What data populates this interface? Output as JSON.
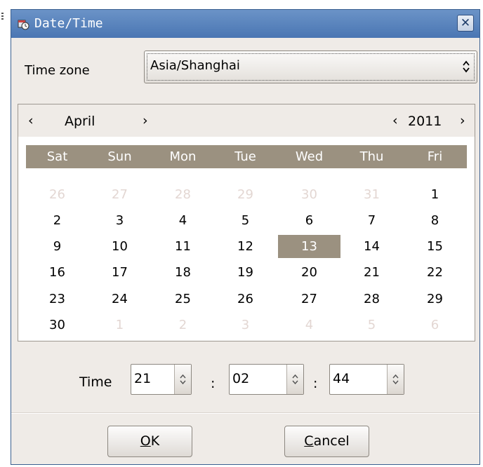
{
  "window": {
    "title": "Date/Time"
  },
  "timezone": {
    "label": "Time zone",
    "value": "Asia/Shanghai"
  },
  "calendar": {
    "prev_month": "‹",
    "month": "April",
    "next_month": "›",
    "prev_year": "‹",
    "year": "2011",
    "next_year": "›",
    "weekdays": [
      "Sat",
      "Sun",
      "Mon",
      "Tue",
      "Wed",
      "Thu",
      "Fri"
    ],
    "weeks": [
      [
        "26",
        "27",
        "28",
        "29",
        "30",
        "31",
        "1"
      ],
      [
        "2",
        "3",
        "4",
        "5",
        "6",
        "7",
        "8"
      ],
      [
        "9",
        "10",
        "11",
        "12",
        "13",
        "14",
        "15"
      ],
      [
        "16",
        "17",
        "18",
        "19",
        "20",
        "21",
        "22"
      ],
      [
        "23",
        "24",
        "25",
        "26",
        "27",
        "28",
        "29"
      ],
      [
        "30",
        "1",
        "2",
        "3",
        "4",
        "5",
        "6"
      ]
    ],
    "selected_day": "13"
  },
  "time": {
    "label": "Time",
    "hour": "21",
    "minute": "02",
    "second": "44",
    "separator": ":"
  },
  "buttons": {
    "ok_label": "OK",
    "cancel_label": "Cancel"
  },
  "colors": {
    "titlebar": "#4a76b3",
    "weekday_header": "#9b9180",
    "selected_day": "#9b9180",
    "other_month_day": "#e3d7d3"
  }
}
